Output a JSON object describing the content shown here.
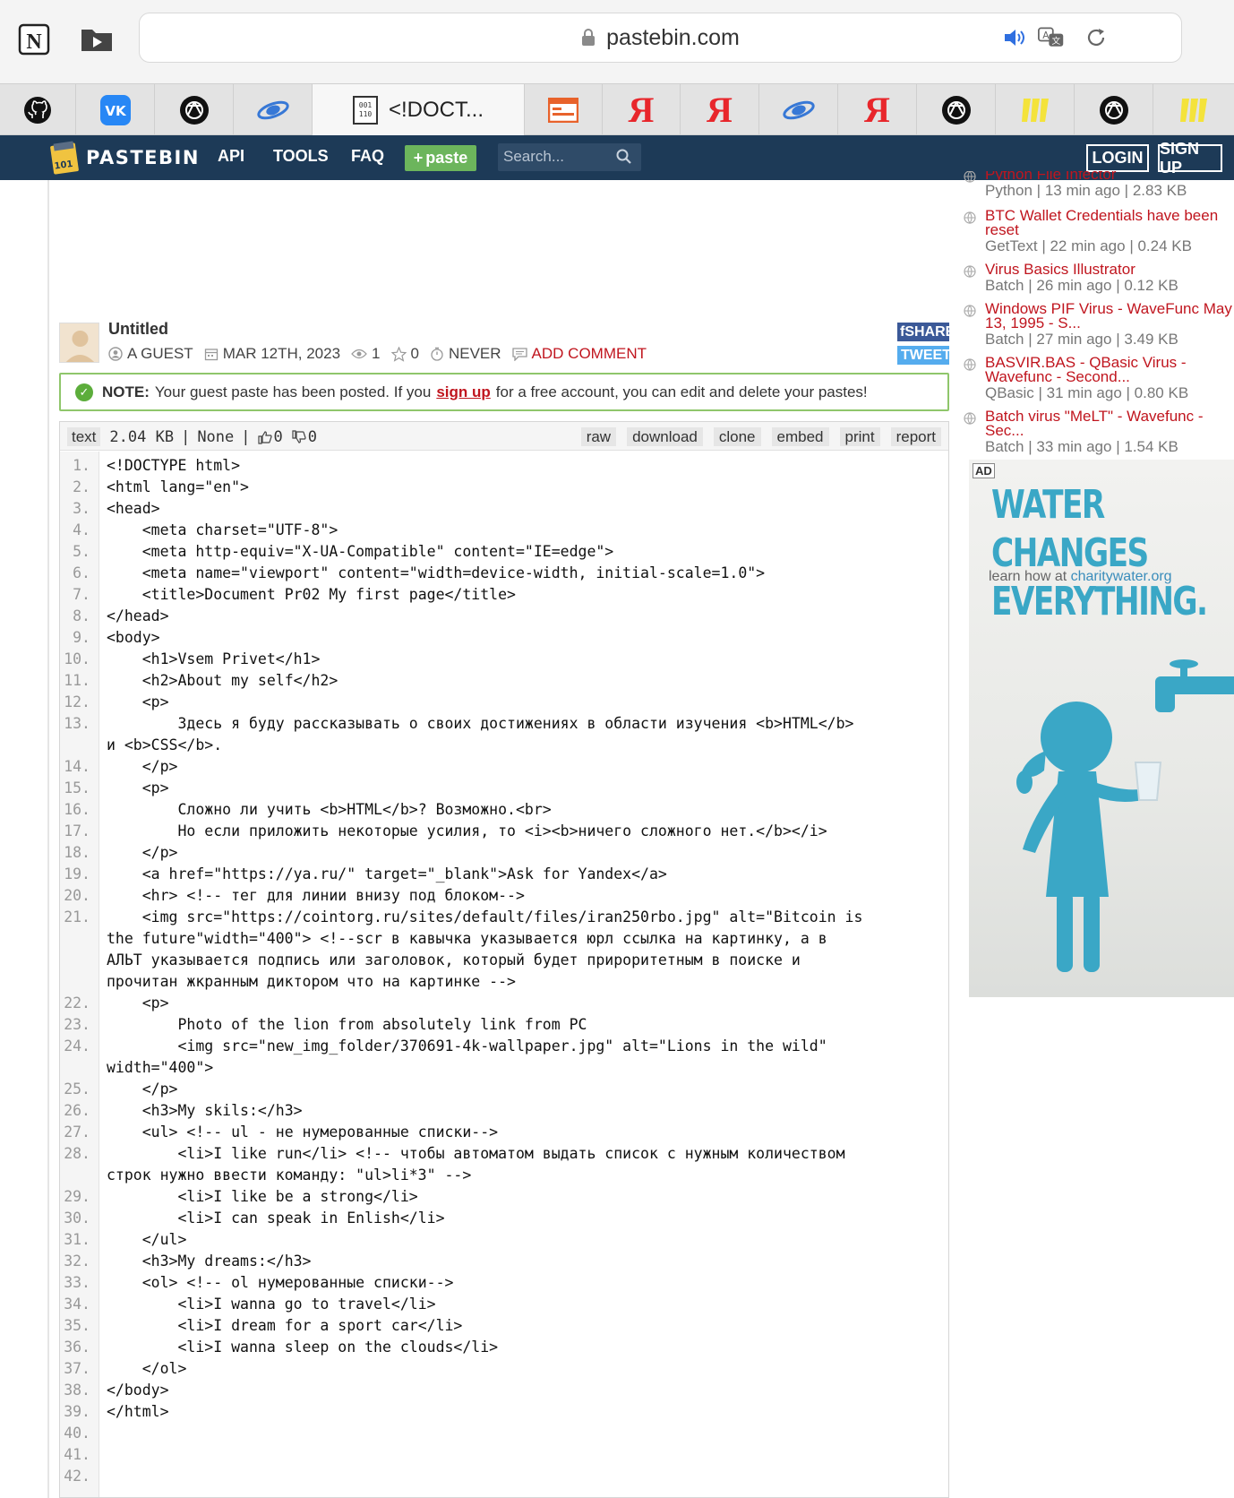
{
  "browser": {
    "url": "pastebin.com",
    "tabs": [
      {
        "icon": "github-icon"
      },
      {
        "icon": "vk-icon"
      },
      {
        "icon": "openai-icon"
      },
      {
        "icon": "saturn-icon"
      },
      {
        "icon": "code-file-icon",
        "title": "<!DOCT..."
      },
      {
        "icon": "browser-window-icon"
      },
      {
        "icon": "yandex-icon",
        "glyph": "Я"
      },
      {
        "icon": "yandex-icon",
        "glyph": "Я"
      },
      {
        "icon": "saturn-icon"
      },
      {
        "icon": "yandex-icon",
        "glyph": "Я"
      },
      {
        "icon": "openai-icon"
      },
      {
        "icon": "stripes-icon"
      },
      {
        "icon": "openai-icon"
      },
      {
        "icon": "stripes-icon"
      }
    ]
  },
  "header": {
    "logo": "PASTEBIN",
    "nav": [
      "API",
      "TOOLS",
      "FAQ"
    ],
    "paste_button": "paste",
    "search_placeholder": "Search...",
    "login": "LOGIN",
    "signup": "SIGN UP"
  },
  "paste": {
    "title": "Untitled",
    "author": "A GUEST",
    "date": "MAR 12TH, 2023",
    "views": "1",
    "stars": "0",
    "expires": "NEVER",
    "add_comment": "ADD COMMENT",
    "share": "SHARE",
    "tweet": "TWEET"
  },
  "notice": {
    "label": "NOTE:",
    "text_before": "Your guest paste has been posted. If you",
    "link": "sign up",
    "text_after": "for a free account, you can edit and delete your pastes!"
  },
  "toolbar": {
    "syntax": "text",
    "size": "2.04 KB",
    "category": "None",
    "likes": "0",
    "dislikes": "0",
    "buttons": [
      "raw",
      "download",
      "clone",
      "embed",
      "print",
      "report"
    ]
  },
  "code": [
    {
      "n": "1.",
      "t": "<!DOCTYPE html>"
    },
    {
      "n": "2.",
      "t": "<html lang=\"en\">"
    },
    {
      "n": "3.",
      "t": "<head>"
    },
    {
      "n": "4.",
      "t": "    <meta charset=\"UTF-8\">"
    },
    {
      "n": "5.",
      "t": "    <meta http-equiv=\"X-UA-Compatible\" content=\"IE=edge\">"
    },
    {
      "n": "6.",
      "t": "    <meta name=\"viewport\" content=\"width=device-width, initial-scale=1.0\">"
    },
    {
      "n": "7.",
      "t": "    <title>Document Pr02 My first page</title>"
    },
    {
      "n": "8.",
      "t": "</head>"
    },
    {
      "n": "9.",
      "t": "<body>"
    },
    {
      "n": "10.",
      "t": "    <h1>Vsem Privet</h1>"
    },
    {
      "n": "11.",
      "t": "    <h2>About my self</h2>"
    },
    {
      "n": "12.",
      "t": "    <p>"
    },
    {
      "n": "13.",
      "t": "        Здесь я буду рассказывать о своих достижениях в области изучения <b>HTML</b>\nи <b>CSS</b>."
    },
    {
      "n": "14.",
      "t": "    </p>"
    },
    {
      "n": "15.",
      "t": "    <p>"
    },
    {
      "n": "16.",
      "t": "        Сложно ли учить <b>HTML</b>? Возможно.<br>"
    },
    {
      "n": "17.",
      "t": "        Но если приложить некоторые усилия, то <i><b>ничего сложного нет.</b></i>"
    },
    {
      "n": "18.",
      "t": "    </p>"
    },
    {
      "n": "19.",
      "t": "    <a href=\"https://ya.ru/\" target=\"_blank\">Ask for Yandex</a>"
    },
    {
      "n": "20.",
      "t": "    <hr> <!-- тег для линии внизу под блоком-->"
    },
    {
      "n": "21.",
      "t": "    <img src=\"https://cointorg.ru/sites/default/files/iran250rbo.jpg\" alt=\"Bitcoin is\nthe future\"width=\"400\"> <!--scr в кавычка указывается юрл ссылка на картинку, а в\nАЛЬТ указывается подпись или заголовок, который будет прироритетным в поиске и\nпрочитан жкранным диктором что на картинке -->"
    },
    {
      "n": "22.",
      "t": "    <p>"
    },
    {
      "n": "23.",
      "t": "        Photo of the lion from absolutely link from PC"
    },
    {
      "n": "24.",
      "t": "        <img src=\"new_img_folder/370691-4k-wallpaper.jpg\" alt=\"Lions in the wild\"\nwidth=\"400\">"
    },
    {
      "n": "25.",
      "t": "    </p>"
    },
    {
      "n": "26.",
      "t": "    <h3>My skils:</h3>"
    },
    {
      "n": "27.",
      "t": "    <ul> <!-- ul - не нумерованные списки-->"
    },
    {
      "n": "28.",
      "t": "        <li>I like run</li> <!-- чтобы автоматом выдать список с нужным количеством\nстрок нужно ввести команду: \"ul>li*3\" -->"
    },
    {
      "n": "29.",
      "t": "        <li>I like be a strong</li>"
    },
    {
      "n": "30.",
      "t": "        <li>I can speak in Enlish</li>"
    },
    {
      "n": "31.",
      "t": "    </ul>"
    },
    {
      "n": "32.",
      "t": "    <h3>My dreams:</h3>"
    },
    {
      "n": "33.",
      "t": "    <ol> <!-- ol нумерованные списки-->"
    },
    {
      "n": "34.",
      "t": "        <li>I wanna go to travel</li>"
    },
    {
      "n": "35.",
      "t": "        <li>I dream for a sport car</li>"
    },
    {
      "n": "36.",
      "t": "        <li>I wanna sleep on the clouds</li>"
    },
    {
      "n": "37.",
      "t": "    </ol>"
    },
    {
      "n": "38.",
      "t": "</body>"
    },
    {
      "n": "39.",
      "t": "</html>"
    },
    {
      "n": "40.",
      "t": ""
    },
    {
      "n": "41.",
      "t": ""
    },
    {
      "n": "42.",
      "t": ""
    }
  ],
  "sidebar": {
    "recent": [
      {
        "title": "Python File Infector",
        "lang": "Python",
        "ago": "13 min ago",
        "size": "2.83 KB"
      },
      {
        "title": "BTC Wallet Credentials have been reset",
        "lang": "GetText",
        "ago": "22 min ago",
        "size": "0.24 KB"
      },
      {
        "title": "Virus Basics Illustrator",
        "lang": "Batch",
        "ago": "26 min ago",
        "size": "0.12 KB"
      },
      {
        "title": "Windows PIF Virus - WaveFunc May 13, 1995 - S...",
        "lang": "Batch",
        "ago": "27 min ago",
        "size": "3.49 KB"
      },
      {
        "title": "BASVIR.BAS - QBasic Virus - Wavefunc - Second...",
        "lang": "QBasic",
        "ago": "31 min ago",
        "size": "0.80 KB"
      },
      {
        "title": "Batch virus \"MeLT\" - Wavefunc - Sec...",
        "lang": "Batch",
        "ago": "33 min ago",
        "size": "1.54 KB"
      }
    ],
    "ad": {
      "badge": "AD",
      "headline": "WATER CHANGES\nEVERYTHING.",
      "sub_prefix": "learn how at",
      "sub_link": "charitywater.org"
    }
  },
  "colors": {
    "header_bg": "#1d3a57",
    "link_red": "#c0151e",
    "paste_green": "#6cb55c",
    "ad_blue": "#3aa7c6"
  }
}
